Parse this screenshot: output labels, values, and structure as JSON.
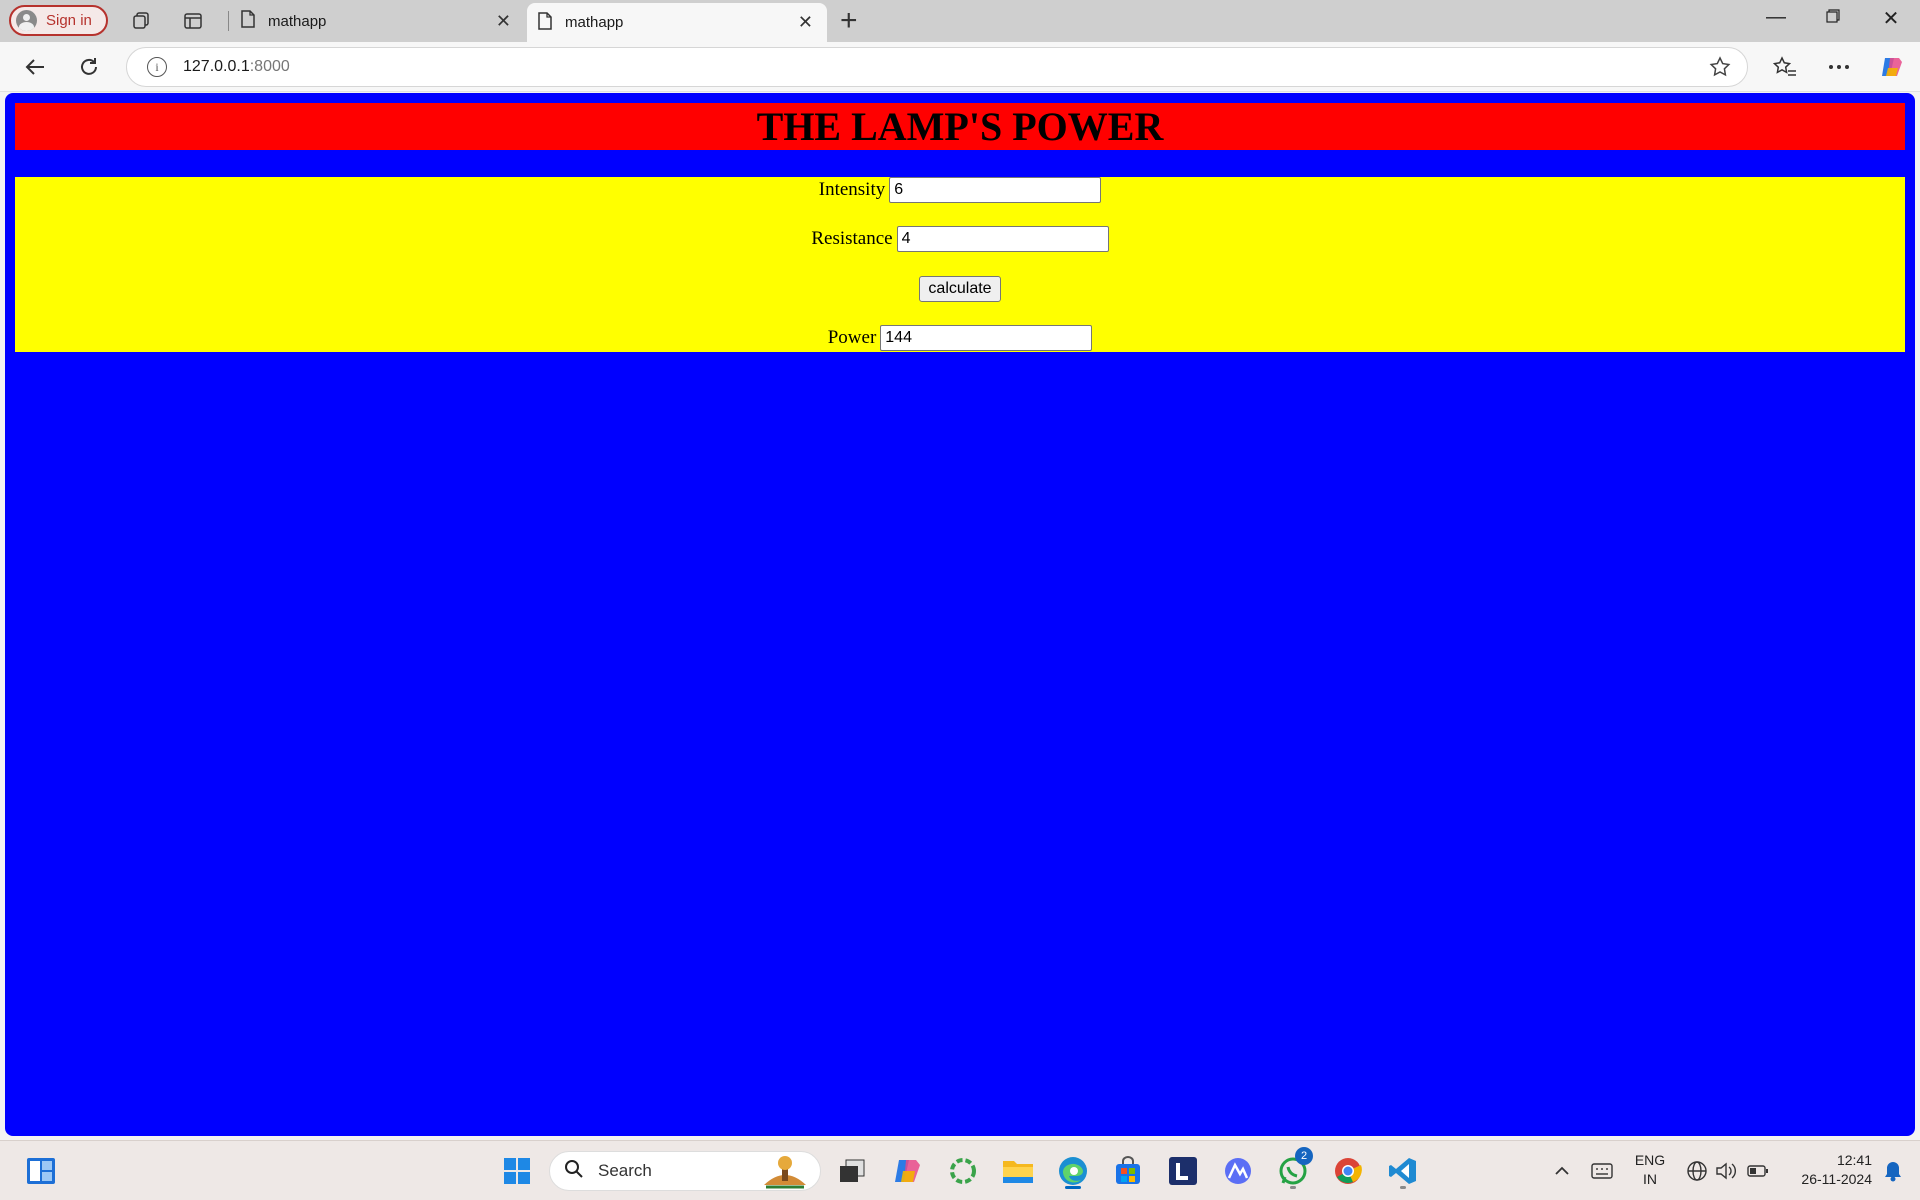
{
  "browser": {
    "signin_label": "Sign in",
    "tabs": [
      {
        "title": "mathapp",
        "active": false
      },
      {
        "title": "mathapp",
        "active": true
      }
    ],
    "url_host": "127.0.0.1",
    "url_port": ":8000"
  },
  "page": {
    "title": "THE LAMP'S POWER",
    "fields": {
      "intensity": {
        "label": "Intensity",
        "value": "6"
      },
      "resistance": {
        "label": "Resistance",
        "value": "4"
      },
      "power": {
        "label": "Power",
        "value": "144"
      }
    },
    "calculate_label": "calculate",
    "colors": {
      "page_bg": "#0000ff",
      "header_bg": "#ff0000",
      "form_bg": "#ffff00"
    }
  },
  "taskbar": {
    "search_label": "Search",
    "whatsapp_badge": "2",
    "lang_line1": "ENG",
    "lang_line2": "IN",
    "time": "12:41",
    "date": "26-11-2024",
    "icons": [
      "widgets-icon",
      "start-icon",
      "search-icon",
      "task-view-icon",
      "copilot-icon",
      "loop-icon",
      "file-explorer-icon",
      "edge-icon",
      "store-icon",
      "l-app-icon",
      "linear-icon",
      "whatsapp-icon",
      "chrome-icon",
      "vscode-icon"
    ]
  }
}
